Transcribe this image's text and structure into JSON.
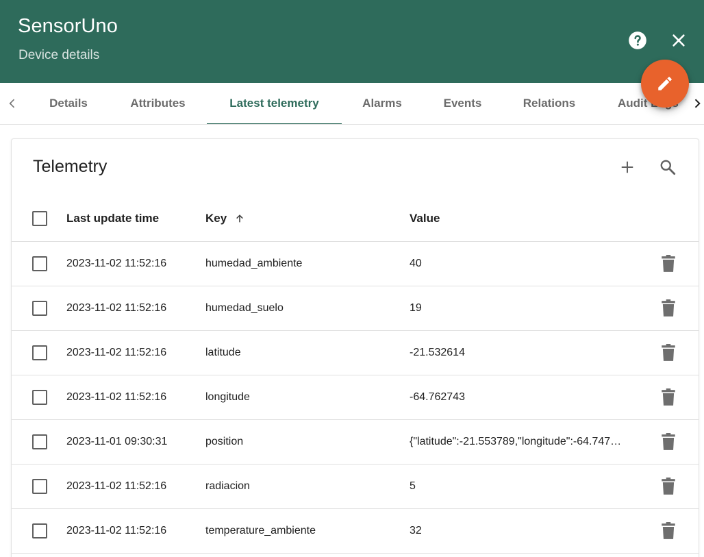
{
  "header": {
    "title": "SensorUno",
    "subtitle": "Device details",
    "help_icon": "help-circle-icon",
    "close_icon": "close-icon",
    "background_color": "#2e6b5b"
  },
  "fab": {
    "icon": "pencil-icon",
    "color": "#e8622c"
  },
  "tabs": [
    {
      "label": "Details"
    },
    {
      "label": "Attributes"
    },
    {
      "label": "Latest telemetry",
      "active": true
    },
    {
      "label": "Alarms"
    },
    {
      "label": "Events"
    },
    {
      "label": "Relations"
    },
    {
      "label": "Audit Logs"
    }
  ],
  "telemetry": {
    "title": "Telemetry",
    "columns": {
      "time": "Last update time",
      "key": "Key",
      "value": "Value"
    },
    "sort": {
      "column": "key",
      "direction": "ascending"
    },
    "rows": [
      {
        "time": "2023-11-02 11:52:16",
        "key": "humedad_ambiente",
        "value": "40"
      },
      {
        "time": "2023-11-02 11:52:16",
        "key": "humedad_suelo",
        "value": "19"
      },
      {
        "time": "2023-11-02 11:52:16",
        "key": "latitude",
        "value": "-21.532614"
      },
      {
        "time": "2023-11-02 11:52:16",
        "key": "longitude",
        "value": "-64.762743"
      },
      {
        "time": "2023-11-01 09:30:31",
        "key": "position",
        "value": "{\"latitude\":-21.553789,\"longitude\":-64.747…"
      },
      {
        "time": "2023-11-02 11:52:16",
        "key": "radiacion",
        "value": "5"
      },
      {
        "time": "2023-11-02 11:52:16",
        "key": "temperature_ambiente",
        "value": "32"
      }
    ]
  }
}
